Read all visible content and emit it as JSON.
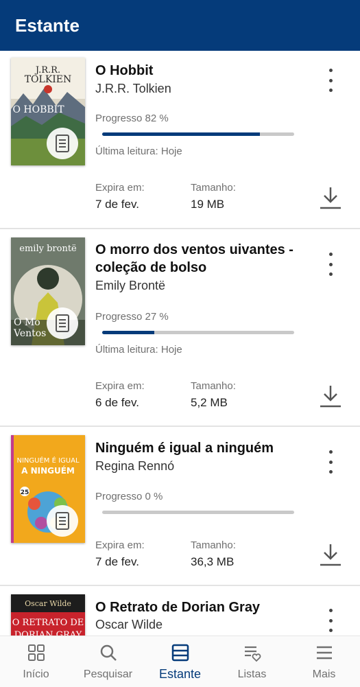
{
  "header": {
    "title": "Estante"
  },
  "labels": {
    "expires": "Expira em:",
    "size": "Tamanho:"
  },
  "books": [
    {
      "title": "O Hobbit",
      "author": "J.R.R. Tolkien",
      "progress_text": "Progresso 82 %",
      "progress": 0.82,
      "last_read": "Última leitura: Hoje",
      "expires": "7 de fev.",
      "size": "19 MB",
      "cover": {
        "line1": "J.R.R.",
        "line2": "TOLKIEN",
        "line3": "O HOBBIT"
      }
    },
    {
      "title": "O morro dos ventos uivantes - coleção de bolso",
      "author": "Emily Brontë",
      "progress_text": "Progresso 27 %",
      "progress": 0.27,
      "last_read": "Última leitura: Hoje",
      "expires": "6 de fev.",
      "size": "5,2 MB",
      "cover": {
        "line1": "emily brontë",
        "line2": "O Mo",
        "line3": "Ventos"
      }
    },
    {
      "title": "Ninguém é igual a ninguém",
      "author": "Regina Rennó",
      "progress_text": "Progresso 0 %",
      "progress": 0.0,
      "expires": "7 de fev.",
      "size": "36,3 MB",
      "cover": {
        "line1": "NINGUÉM É IGUAL",
        "line2": "A NINGUÉM",
        "line3": "25"
      }
    },
    {
      "title": "O Retrato de Dorian Gray",
      "author": "Oscar Wilde",
      "cover": {
        "line1": "Oscar Wilde",
        "line2": "O RETRATO DE",
        "line3": "DORIAN GRAY"
      }
    }
  ],
  "nav": [
    {
      "label": "Início",
      "icon": "grid-icon"
    },
    {
      "label": "Pesquisar",
      "icon": "search-icon"
    },
    {
      "label": "Estante",
      "icon": "shelf-icon",
      "active": true
    },
    {
      "label": "Listas",
      "icon": "list-heart-icon"
    },
    {
      "label": "Mais",
      "icon": "menu-icon"
    }
  ],
  "colors": {
    "primary": "#053b7a",
    "track": "#c9c9c9"
  }
}
